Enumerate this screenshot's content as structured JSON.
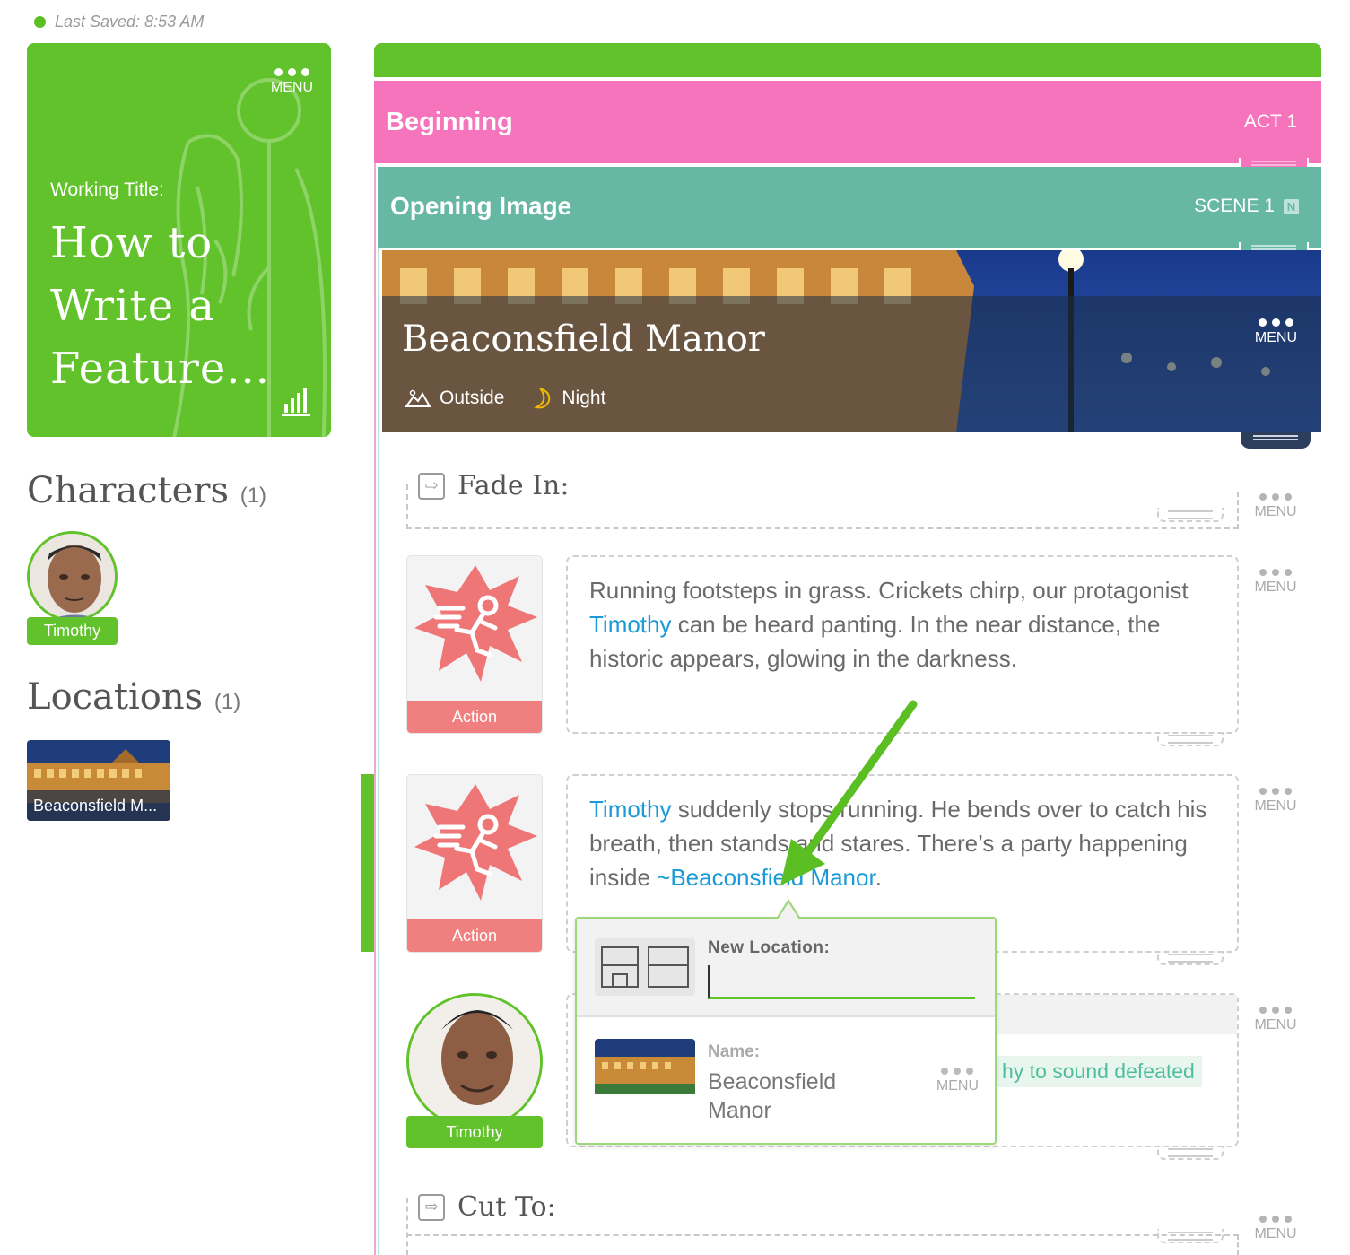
{
  "status": {
    "text": "Last Saved: 8:53 AM"
  },
  "project": {
    "menu_label": "MENU",
    "working_title_label": "Working Title:",
    "title": "How to Write a Feature..."
  },
  "sidebar": {
    "characters_heading": "Characters",
    "characters_count": "(1)",
    "characters": [
      {
        "name": "Timothy"
      }
    ],
    "locations_heading": "Locations",
    "locations_count": "(1)",
    "locations": [
      {
        "name": "Beaconsfield M..."
      }
    ]
  },
  "act": {
    "title": "Beginning",
    "label": "ACT 1"
  },
  "scene": {
    "title": "Opening Image",
    "label": "SCENE 1",
    "badge": "N"
  },
  "location_banner": {
    "name": "Beaconsfield Manor",
    "setting": "Outside",
    "time": "Night",
    "menu_label": "MENU"
  },
  "blocks": {
    "fade_in": "Fade In:",
    "cut_to": "Cut To:",
    "menu_label": "MENU",
    "action1": {
      "tile_label": "Action",
      "link": "Timothy",
      "text_before": "Running footsteps in grass. Crickets chirp, our protagonist ",
      "text_after": " can be heard panting. In the near distance, the historic appears, glowing in the darkness."
    },
    "action2": {
      "tile_label": "Action",
      "link": "Timothy",
      "text_mid": " suddenly stops running. He bends over to catch his breath, then stands and stares. There’s a party happening inside ",
      "link2": "~Beaconsfield Manor",
      "text_end": "."
    },
    "dialogue": {
      "character": "Timothy",
      "parenthetical": "hy to sound defeated"
    }
  },
  "popup": {
    "new_location_label": "New Location:",
    "input_value": "",
    "name_label": "Name:",
    "name_value": "Beaconsfield Manor",
    "menu_label": "MENU"
  },
  "colors": {
    "brand_green": "#62c22b",
    "act_pink": "#f574bc",
    "scene_teal": "#66b7a3",
    "action_red": "#f08080",
    "link_blue": "#1a9ad6"
  }
}
